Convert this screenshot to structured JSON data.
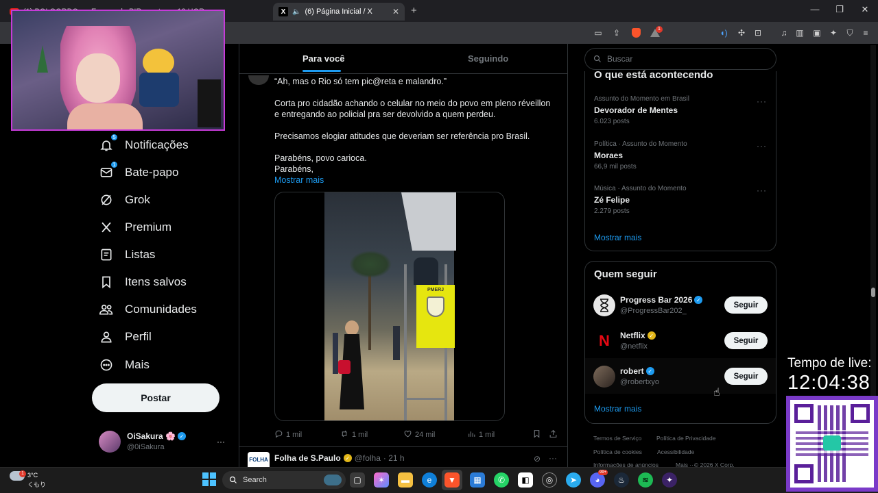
{
  "browser": {
    "tabs": [
      {
        "title": "(1) BOLGORDO - o Espaço de PIR... ... trasa 12 HOR",
        "active": false
      },
      {
        "title": "(6) Página Inicial / X",
        "active": true
      }
    ],
    "new_tab": "+",
    "extension_badge": "1"
  },
  "nav": {
    "items": [
      {
        "label": "Notificações",
        "icon": "bell-icon",
        "badge": "5"
      },
      {
        "label": "Bate-papo",
        "icon": "mail-icon",
        "badge": "1"
      },
      {
        "label": "Grok",
        "icon": "grok-icon"
      },
      {
        "label": "Premium",
        "icon": "x-logo-icon"
      },
      {
        "label": "Listas",
        "icon": "list-icon"
      },
      {
        "label": "Itens salvos",
        "icon": "bookmark-icon"
      },
      {
        "label": "Comunidades",
        "icon": "people-icon"
      },
      {
        "label": "Perfil",
        "icon": "person-icon"
      },
      {
        "label": "Mais",
        "icon": "more-circle-icon"
      }
    ],
    "post_button": "Postar",
    "account": {
      "name": "OiSakura 🌸",
      "handle": "@0iSakura",
      "more": "···"
    }
  },
  "feed": {
    "tabs": [
      "Para você",
      "Seguindo"
    ],
    "tweet": {
      "quote": "“Ah, mas o Rio só tem pic@reta e malandro.”",
      "p1": "Corta pro cidadão achando o celular no meio do povo em pleno réveillon e entregando ao policial pra ser devolvido a quem perdeu.",
      "p2": "Precisamos elogiar atitudes que deveriam ser referência pro Brasil.",
      "p3": "Parabéns, povo carioca.",
      "p4": "Parabéns,",
      "show_more": "Mostrar mais",
      "video_sign": "PMERJ",
      "actions": {
        "replies": "1 mil",
        "retweets": "1 mil",
        "likes": "24 mil",
        "views": "1 mil"
      }
    },
    "next_tweet": {
      "avatar_text": "FOLHA",
      "name": "Folha de S.Paulo",
      "handle": "@folha",
      "time": "· 21 h"
    }
  },
  "sidebar": {
    "search_placeholder": "Buscar",
    "trends_title": "O que está acontecendo",
    "trends": [
      {
        "meta": "Assunto do Momento em Brasil",
        "name": "Devorador de Mentes",
        "count": "6.023 posts"
      },
      {
        "meta": "Política · Assunto do Momento",
        "name": "Moraes",
        "count": "66,9 mil posts"
      },
      {
        "meta": "Música · Assunto do Momento",
        "name": "Zé Felipe",
        "count": "2.279 posts"
      }
    ],
    "trends_more": "Mostrar mais",
    "follow_title": "Quem seguir",
    "follow": [
      {
        "name": "Progress Bar 2026",
        "handle": "@ProgressBar202_",
        "badge": "blue",
        "button": "Seguir"
      },
      {
        "name": "Netflix",
        "handle": "@netflix",
        "badge": "gold",
        "button": "Seguir"
      },
      {
        "name": "robert",
        "handle": "@robertxyo",
        "badge": "blue",
        "button": "Seguir"
      }
    ],
    "follow_more": "Mostrar mais",
    "footer": {
      "terms": "Termos de Serviço",
      "privacy": "Política de Privacidade",
      "cookies": "Política de cookies",
      "access": "Acessibilidade",
      "ads": "Informações de anúncios",
      "more": "Mais ···",
      "copyright": "© 2026 X Corp."
    }
  },
  "taskbar": {
    "weather_temp": "3°C",
    "weather_desc": "くもり",
    "weather_badge": "1",
    "search_label": "Search",
    "discord_badge": "99+"
  },
  "overlay": {
    "live_label": "Tempo de live:",
    "live_time": "12:04:38"
  },
  "colors": {
    "accent": "#1d9bf0",
    "background": "#000000",
    "border": "#2f3336",
    "muted": "#71767b"
  }
}
